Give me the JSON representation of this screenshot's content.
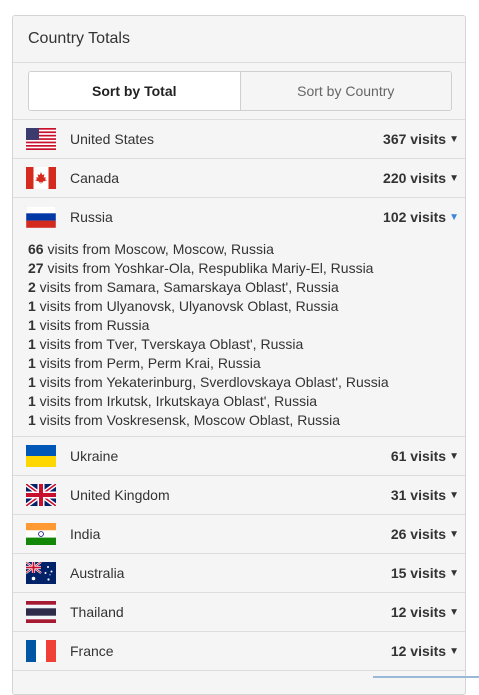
{
  "panel": {
    "title": "Country Totals"
  },
  "tabs": [
    {
      "label": "Sort by Total",
      "active": true
    },
    {
      "label": "Sort by Country",
      "active": false
    }
  ],
  "countries": [
    {
      "name": "United States",
      "visits": "367 visits",
      "flag": "us-flag"
    },
    {
      "name": "Canada",
      "visits": "220 visits",
      "flag": "canada-flag"
    },
    {
      "name": "Russia",
      "visits": "102 visits",
      "flag": "russia-flag",
      "expanded": true,
      "details": [
        {
          "count": "66",
          "text": " visits from Moscow, Moscow, Russia"
        },
        {
          "count": "27",
          "text": " visits from Yoshkar-Ola, Respublika Mariy-El, Russia"
        },
        {
          "count": "2",
          "text": " visits from Samara, Samarskaya Oblast', Russia"
        },
        {
          "count": "1",
          "text": " visits from Ulyanovsk, Ulyanovsk Oblast, Russia"
        },
        {
          "count": "1",
          "text": " visits from Russia"
        },
        {
          "count": "1",
          "text": " visits from Tver, Tverskaya Oblast', Russia"
        },
        {
          "count": "1",
          "text": " visits from Perm, Perm Krai, Russia"
        },
        {
          "count": "1",
          "text": " visits from Yekaterinburg, Sverdlovskaya Oblast', Russia"
        },
        {
          "count": "1",
          "text": " visits from Irkutsk, Irkutskaya Oblast', Russia"
        },
        {
          "count": "1",
          "text": " visits from Voskresensk, Moscow Oblast, Russia"
        }
      ]
    },
    {
      "name": "Ukraine",
      "visits": "61 visits",
      "flag": "ukraine-flag"
    },
    {
      "name": "United Kingdom",
      "visits": "31 visits",
      "flag": "uk-flag"
    },
    {
      "name": "India",
      "visits": "26 visits",
      "flag": "india-flag"
    },
    {
      "name": "Australia",
      "visits": "15 visits",
      "flag": "australia-flag"
    },
    {
      "name": "Thailand",
      "visits": "12 visits",
      "flag": "thailand-flag"
    },
    {
      "name": "France",
      "visits": "12 visits",
      "flag": "france-flag"
    }
  ],
  "colors": {
    "expanded_caret": "#3a87d6",
    "panel_bg": "#f5f5f5",
    "border": "#dddddd"
  }
}
